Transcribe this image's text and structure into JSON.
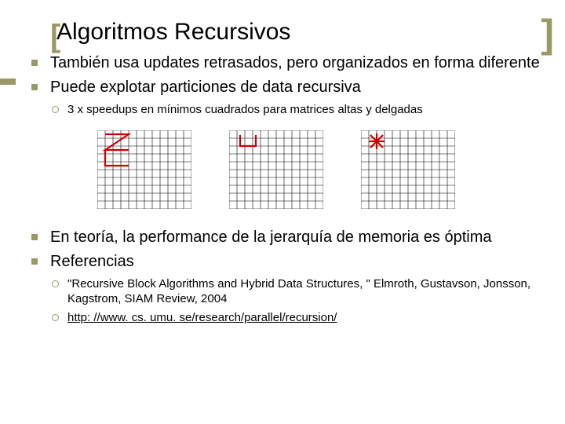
{
  "title": "Algoritmos Recursivos",
  "bullets": {
    "b1": "También usa updates retrasados, pero organizados en forma diferente",
    "b2": "Puede explotar particiones de data recursiva",
    "b2_sub1": "3 x speedups en mínimos cuadrados para matrices altas y delgadas",
    "b3": "En teoría, la performance de la jerarquía de memoria es óptima",
    "b4": "Referencias",
    "ref1": "\"Recursive Block Algorithms and Hybrid Data Structures, \" Elmroth, Gustavson, Jonsson, Kagstrom, SIAM Review, 2004",
    "ref2": "http: //www. cs. umu. se/research/parallel/recursion/"
  },
  "grids": {
    "cols": 12,
    "rows": 10,
    "z_color": "#cc0000",
    "u_color": "#cc0000",
    "star_color": "#cc0000"
  }
}
